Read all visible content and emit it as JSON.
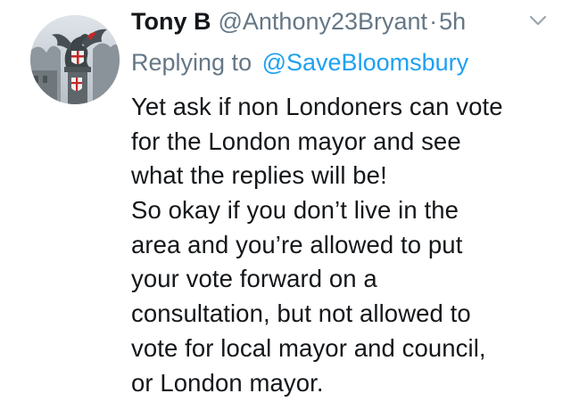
{
  "tweet": {
    "display_name": "Tony B",
    "handle": "@Anthony23Bryant",
    "separator": "·",
    "time": "5h",
    "menu_icon": "chevron-down-icon",
    "avatar_icon": "dragon-statue-avatar",
    "replying_to_label": "Replying to",
    "replying_to_handle": "@SaveBloomsbury",
    "body_lines": [
      "Yet ask if non Londoners can vote",
      "for the London mayor and see",
      "what the replies will be!",
      "So okay if you don’t live in the",
      "area and you’re allowed to put",
      "your vote forward on a",
      "consultation, but not allowed to",
      "vote for local mayor and council,",
      "or London mayor."
    ]
  },
  "colors": {
    "text": "#14171a",
    "secondary_text": "#657786",
    "link": "#1da1f2",
    "background": "#ffffff"
  }
}
